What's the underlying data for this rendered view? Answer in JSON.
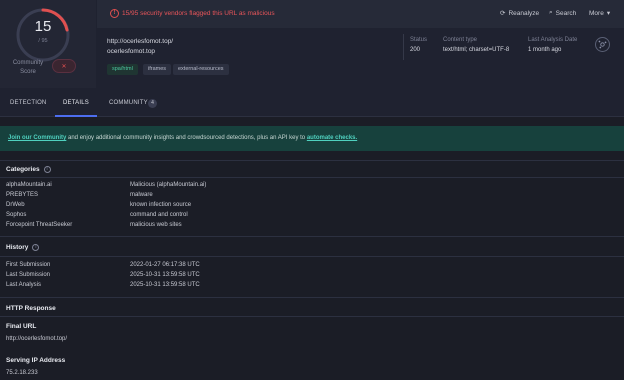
{
  "score": {
    "value": "15",
    "total": "/ 95",
    "community_label": "Community Score",
    "community_icon": "x-circle-icon"
  },
  "alert": "15/95 security vendors flagged this URL as malicious",
  "actions": {
    "reanalyze": "Reanalyze",
    "search": "Search",
    "more": "More"
  },
  "url": {
    "full": "http://ocerlesfomot.top/",
    "domain": "ocerlesfomot.top"
  },
  "tags": [
    "spa/html",
    "iframes",
    "external-resources"
  ],
  "meta": {
    "status_label": "Status",
    "status": "200",
    "content_type_label": "Content type",
    "content_type": "text/html; charset=UTF-8",
    "last_analysis_label": "Last Analysis Date",
    "last_analysis": "1 month ago"
  },
  "tabs": {
    "detection": "DETECTION",
    "details": "DETAILS",
    "community": "COMMUNITY",
    "community_count": "4"
  },
  "banner": {
    "join": "Join our Community",
    "middle": " and enjoy additional community insights and crowdsourced detections, plus an API key to ",
    "automate": "automate checks."
  },
  "categories": {
    "title": "Categories",
    "rows": [
      {
        "vendor": "alphaMountain.ai",
        "value": "Malicious (alphaMountain.ai)"
      },
      {
        "vendor": "PREBYTES",
        "value": "malware"
      },
      {
        "vendor": "DrWeb",
        "value": "known infection source"
      },
      {
        "vendor": "Sophos",
        "value": "command and control"
      },
      {
        "vendor": "Forcepoint ThreatSeeker",
        "value": "malicious web sites"
      }
    ]
  },
  "history": {
    "title": "History",
    "rows": [
      {
        "label": "First Submission",
        "value": "2022-01-27 06:17:38 UTC"
      },
      {
        "label": "Last Submission",
        "value": "2025-10-31 13:59:58 UTC"
      },
      {
        "label": "Last Analysis",
        "value": "2025-10-31 13:59:58 UTC"
      }
    ]
  },
  "http_response": {
    "title": "HTTP Response"
  },
  "final_url": {
    "title": "Final URL",
    "value": "http://ocerlesfomot.top/"
  },
  "serving_ip": {
    "title": "Serving IP Address",
    "value": "75.2.18.233"
  },
  "colors": {
    "accent": "#4d6ef0",
    "danger": "#e05050",
    "teal": "#4fd1bf"
  }
}
